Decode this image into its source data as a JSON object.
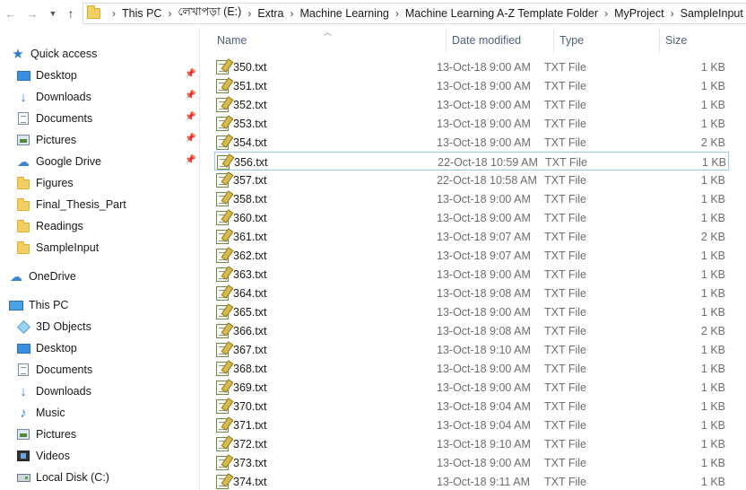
{
  "address": {
    "crumbs": [
      "This PC",
      "লেখাপড়া (E:)",
      "Extra",
      "Machine Learning",
      "Machine Learning A-Z Template Folder",
      "MyProject",
      "SampleInput"
    ]
  },
  "nav": {
    "quick_access": "Quick access",
    "quick_items": [
      "Desktop",
      "Downloads",
      "Documents",
      "Pictures",
      "Google Drive",
      "Figures",
      "Final_Thesis_Part",
      "Readings",
      "SampleInput"
    ],
    "onedrive": "OneDrive",
    "this_pc": "This PC",
    "pc_items": [
      "3D Objects",
      "Desktop",
      "Documents",
      "Downloads",
      "Music",
      "Pictures",
      "Videos",
      "Local Disk (C:)"
    ]
  },
  "columns": {
    "name": "Name",
    "date": "Date modified",
    "type": "Type",
    "size": "Size"
  },
  "files": [
    {
      "name": "350.txt",
      "date": "13-Oct-18 9:00 AM",
      "type": "TXT File",
      "size": "1 KB"
    },
    {
      "name": "351.txt",
      "date": "13-Oct-18 9:00 AM",
      "type": "TXT File",
      "size": "1 KB"
    },
    {
      "name": "352.txt",
      "date": "13-Oct-18 9:00 AM",
      "type": "TXT File",
      "size": "1 KB"
    },
    {
      "name": "353.txt",
      "date": "13-Oct-18 9:00 AM",
      "type": "TXT File",
      "size": "1 KB"
    },
    {
      "name": "354.txt",
      "date": "13-Oct-18 9:00 AM",
      "type": "TXT File",
      "size": "2 KB"
    },
    {
      "name": "356.txt",
      "date": "22-Oct-18 10:59 AM",
      "type": "TXT File",
      "size": "1 KB"
    },
    {
      "name": "357.txt",
      "date": "22-Oct-18 10:58 AM",
      "type": "TXT File",
      "size": "1 KB"
    },
    {
      "name": "358.txt",
      "date": "13-Oct-18 9:00 AM",
      "type": "TXT File",
      "size": "1 KB"
    },
    {
      "name": "360.txt",
      "date": "13-Oct-18 9:00 AM",
      "type": "TXT File",
      "size": "1 KB"
    },
    {
      "name": "361.txt",
      "date": "13-Oct-18 9:07 AM",
      "type": "TXT File",
      "size": "2 KB"
    },
    {
      "name": "362.txt",
      "date": "13-Oct-18 9:07 AM",
      "type": "TXT File",
      "size": "1 KB"
    },
    {
      "name": "363.txt",
      "date": "13-Oct-18 9:00 AM",
      "type": "TXT File",
      "size": "1 KB"
    },
    {
      "name": "364.txt",
      "date": "13-Oct-18 9:08 AM",
      "type": "TXT File",
      "size": "1 KB"
    },
    {
      "name": "365.txt",
      "date": "13-Oct-18 9:00 AM",
      "type": "TXT File",
      "size": "1 KB"
    },
    {
      "name": "366.txt",
      "date": "13-Oct-18 9:08 AM",
      "type": "TXT File",
      "size": "2 KB"
    },
    {
      "name": "367.txt",
      "date": "13-Oct-18 9:10 AM",
      "type": "TXT File",
      "size": "1 KB"
    },
    {
      "name": "368.txt",
      "date": "13-Oct-18 9:00 AM",
      "type": "TXT File",
      "size": "1 KB"
    },
    {
      "name": "369.txt",
      "date": "13-Oct-18 9:00 AM",
      "type": "TXT File",
      "size": "1 KB"
    },
    {
      "name": "370.txt",
      "date": "13-Oct-18 9:04 AM",
      "type": "TXT File",
      "size": "1 KB"
    },
    {
      "name": "371.txt",
      "date": "13-Oct-18 9:04 AM",
      "type": "TXT File",
      "size": "1 KB"
    },
    {
      "name": "372.txt",
      "date": "13-Oct-18 9:10 AM",
      "type": "TXT File",
      "size": "1 KB"
    },
    {
      "name": "373.txt",
      "date": "13-Oct-18 9:00 AM",
      "type": "TXT File",
      "size": "1 KB"
    },
    {
      "name": "374.txt",
      "date": "13-Oct-18 9:11 AM",
      "type": "TXT File",
      "size": "1 KB"
    }
  ],
  "selected_file": "356.txt"
}
